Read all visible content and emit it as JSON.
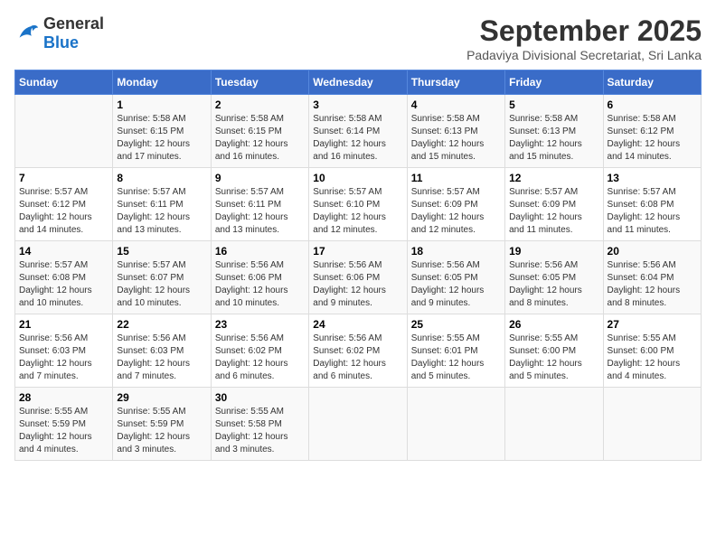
{
  "header": {
    "logo_general": "General",
    "logo_blue": "Blue",
    "month_title": "September 2025",
    "subtitle": "Padaviya Divisional Secretariat, Sri Lanka"
  },
  "days_of_week": [
    "Sunday",
    "Monday",
    "Tuesday",
    "Wednesday",
    "Thursday",
    "Friday",
    "Saturday"
  ],
  "weeks": [
    [
      {
        "day": "",
        "sunrise": "",
        "sunset": "",
        "daylight": ""
      },
      {
        "day": "1",
        "sunrise": "Sunrise: 5:58 AM",
        "sunset": "Sunset: 6:15 PM",
        "daylight": "Daylight: 12 hours and 17 minutes."
      },
      {
        "day": "2",
        "sunrise": "Sunrise: 5:58 AM",
        "sunset": "Sunset: 6:15 PM",
        "daylight": "Daylight: 12 hours and 16 minutes."
      },
      {
        "day": "3",
        "sunrise": "Sunrise: 5:58 AM",
        "sunset": "Sunset: 6:14 PM",
        "daylight": "Daylight: 12 hours and 16 minutes."
      },
      {
        "day": "4",
        "sunrise": "Sunrise: 5:58 AM",
        "sunset": "Sunset: 6:13 PM",
        "daylight": "Daylight: 12 hours and 15 minutes."
      },
      {
        "day": "5",
        "sunrise": "Sunrise: 5:58 AM",
        "sunset": "Sunset: 6:13 PM",
        "daylight": "Daylight: 12 hours and 15 minutes."
      },
      {
        "day": "6",
        "sunrise": "Sunrise: 5:58 AM",
        "sunset": "Sunset: 6:12 PM",
        "daylight": "Daylight: 12 hours and 14 minutes."
      }
    ],
    [
      {
        "day": "7",
        "sunrise": "Sunrise: 5:57 AM",
        "sunset": "Sunset: 6:12 PM",
        "daylight": "Daylight: 12 hours and 14 minutes."
      },
      {
        "day": "8",
        "sunrise": "Sunrise: 5:57 AM",
        "sunset": "Sunset: 6:11 PM",
        "daylight": "Daylight: 12 hours and 13 minutes."
      },
      {
        "day": "9",
        "sunrise": "Sunrise: 5:57 AM",
        "sunset": "Sunset: 6:11 PM",
        "daylight": "Daylight: 12 hours and 13 minutes."
      },
      {
        "day": "10",
        "sunrise": "Sunrise: 5:57 AM",
        "sunset": "Sunset: 6:10 PM",
        "daylight": "Daylight: 12 hours and 12 minutes."
      },
      {
        "day": "11",
        "sunrise": "Sunrise: 5:57 AM",
        "sunset": "Sunset: 6:09 PM",
        "daylight": "Daylight: 12 hours and 12 minutes."
      },
      {
        "day": "12",
        "sunrise": "Sunrise: 5:57 AM",
        "sunset": "Sunset: 6:09 PM",
        "daylight": "Daylight: 12 hours and 11 minutes."
      },
      {
        "day": "13",
        "sunrise": "Sunrise: 5:57 AM",
        "sunset": "Sunset: 6:08 PM",
        "daylight": "Daylight: 12 hours and 11 minutes."
      }
    ],
    [
      {
        "day": "14",
        "sunrise": "Sunrise: 5:57 AM",
        "sunset": "Sunset: 6:08 PM",
        "daylight": "Daylight: 12 hours and 10 minutes."
      },
      {
        "day": "15",
        "sunrise": "Sunrise: 5:57 AM",
        "sunset": "Sunset: 6:07 PM",
        "daylight": "Daylight: 12 hours and 10 minutes."
      },
      {
        "day": "16",
        "sunrise": "Sunrise: 5:56 AM",
        "sunset": "Sunset: 6:06 PM",
        "daylight": "Daylight: 12 hours and 10 minutes."
      },
      {
        "day": "17",
        "sunrise": "Sunrise: 5:56 AM",
        "sunset": "Sunset: 6:06 PM",
        "daylight": "Daylight: 12 hours and 9 minutes."
      },
      {
        "day": "18",
        "sunrise": "Sunrise: 5:56 AM",
        "sunset": "Sunset: 6:05 PM",
        "daylight": "Daylight: 12 hours and 9 minutes."
      },
      {
        "day": "19",
        "sunrise": "Sunrise: 5:56 AM",
        "sunset": "Sunset: 6:05 PM",
        "daylight": "Daylight: 12 hours and 8 minutes."
      },
      {
        "day": "20",
        "sunrise": "Sunrise: 5:56 AM",
        "sunset": "Sunset: 6:04 PM",
        "daylight": "Daylight: 12 hours and 8 minutes."
      }
    ],
    [
      {
        "day": "21",
        "sunrise": "Sunrise: 5:56 AM",
        "sunset": "Sunset: 6:03 PM",
        "daylight": "Daylight: 12 hours and 7 minutes."
      },
      {
        "day": "22",
        "sunrise": "Sunrise: 5:56 AM",
        "sunset": "Sunset: 6:03 PM",
        "daylight": "Daylight: 12 hours and 7 minutes."
      },
      {
        "day": "23",
        "sunrise": "Sunrise: 5:56 AM",
        "sunset": "Sunset: 6:02 PM",
        "daylight": "Daylight: 12 hours and 6 minutes."
      },
      {
        "day": "24",
        "sunrise": "Sunrise: 5:56 AM",
        "sunset": "Sunset: 6:02 PM",
        "daylight": "Daylight: 12 hours and 6 minutes."
      },
      {
        "day": "25",
        "sunrise": "Sunrise: 5:55 AM",
        "sunset": "Sunset: 6:01 PM",
        "daylight": "Daylight: 12 hours and 5 minutes."
      },
      {
        "day": "26",
        "sunrise": "Sunrise: 5:55 AM",
        "sunset": "Sunset: 6:00 PM",
        "daylight": "Daylight: 12 hours and 5 minutes."
      },
      {
        "day": "27",
        "sunrise": "Sunrise: 5:55 AM",
        "sunset": "Sunset: 6:00 PM",
        "daylight": "Daylight: 12 hours and 4 minutes."
      }
    ],
    [
      {
        "day": "28",
        "sunrise": "Sunrise: 5:55 AM",
        "sunset": "Sunset: 5:59 PM",
        "daylight": "Daylight: 12 hours and 4 minutes."
      },
      {
        "day": "29",
        "sunrise": "Sunrise: 5:55 AM",
        "sunset": "Sunset: 5:59 PM",
        "daylight": "Daylight: 12 hours and 3 minutes."
      },
      {
        "day": "30",
        "sunrise": "Sunrise: 5:55 AM",
        "sunset": "Sunset: 5:58 PM",
        "daylight": "Daylight: 12 hours and 3 minutes."
      },
      {
        "day": "",
        "sunrise": "",
        "sunset": "",
        "daylight": ""
      },
      {
        "day": "",
        "sunrise": "",
        "sunset": "",
        "daylight": ""
      },
      {
        "day": "",
        "sunrise": "",
        "sunset": "",
        "daylight": ""
      },
      {
        "day": "",
        "sunrise": "",
        "sunset": "",
        "daylight": ""
      }
    ]
  ]
}
